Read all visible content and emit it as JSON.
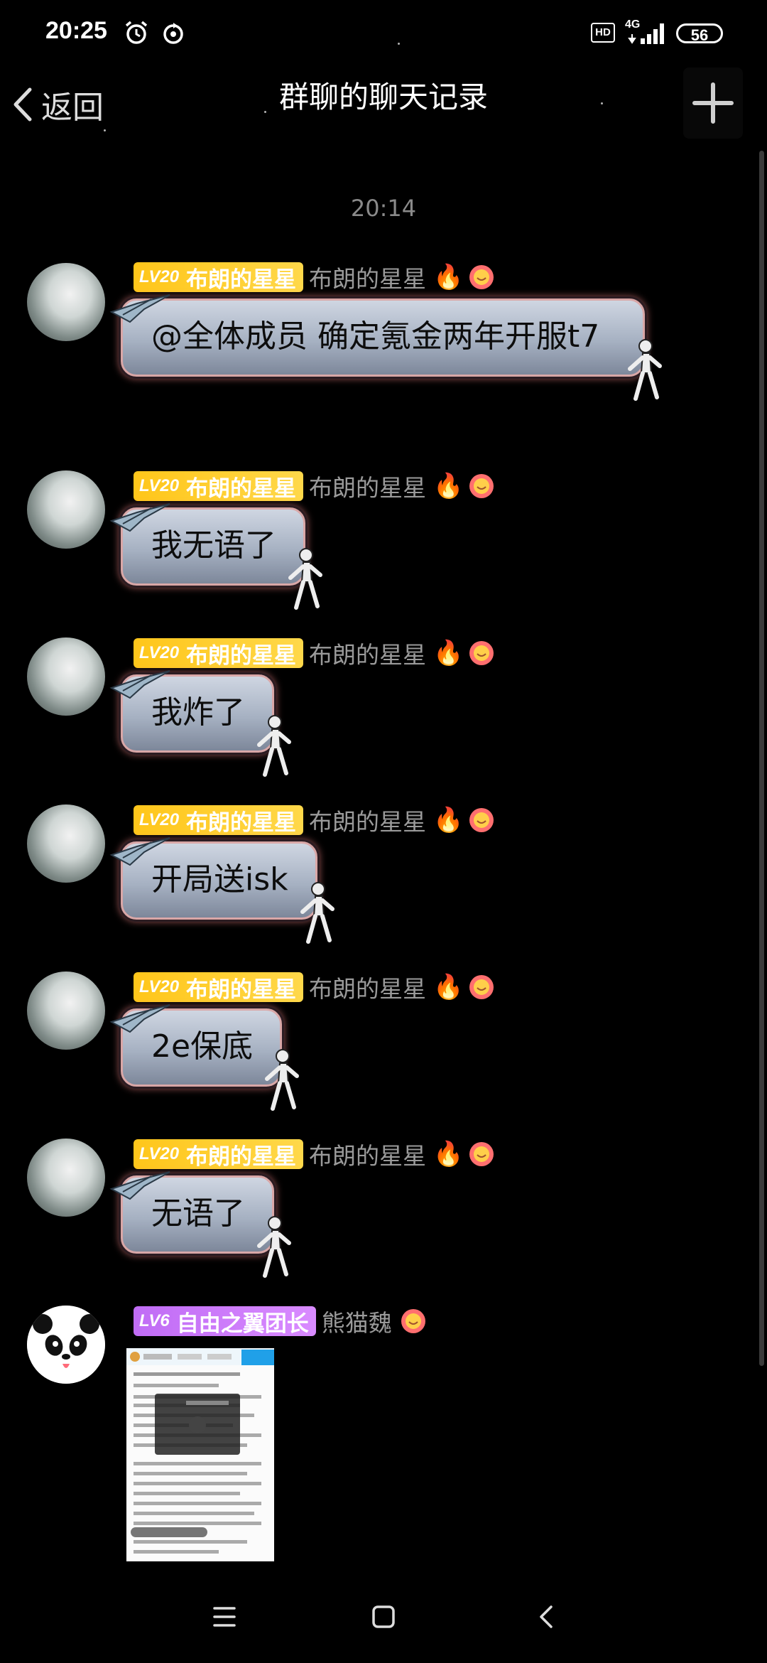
{
  "status_bar": {
    "time": "20:25",
    "alarm_icon": "alarm-clock-icon",
    "sync_icon": "sync-icon",
    "hd_label": "HD",
    "network_label": "4G",
    "battery": "56"
  },
  "nav": {
    "back_label": "返回",
    "title": "群聊的聊天记录",
    "plus_icon": "plus-icon"
  },
  "timestamp": "20:14",
  "messages": [
    {
      "level": "LV20",
      "title": "布朗的星星",
      "name": "布朗的星星",
      "text": "@全体成员 确定氪金两年开服t7"
    },
    {
      "level": "LV20",
      "title": "布朗的星星",
      "name": "布朗的星星",
      "text": "我无语了"
    },
    {
      "level": "LV20",
      "title": "布朗的星星",
      "name": "布朗的星星",
      "text": "我炸了"
    },
    {
      "level": "LV20",
      "title": "布朗的星星",
      "name": "布朗的星星",
      "text": "开局送isk"
    },
    {
      "level": "LV20",
      "title": "布朗的星星",
      "name": "布朗的星星",
      "text": "2e保底"
    },
    {
      "level": "LV20",
      "title": "布朗的星星",
      "name": "布朗的星星",
      "text": "无语了"
    },
    {
      "level": "LV6",
      "title": "自由之翼团长",
      "name": "熊猫魏",
      "image": "screenshot-thumbnail"
    }
  ],
  "colors": {
    "background": "#000000",
    "gold_tag": "#ffc61a",
    "purple_tag": "#c06cf5",
    "bubble": "#a6b1c2"
  }
}
